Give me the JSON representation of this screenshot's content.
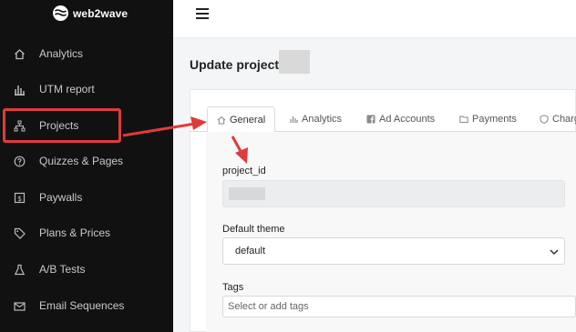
{
  "app": {
    "name": "web2wave"
  },
  "sidebar": {
    "items": [
      {
        "label": "Analytics",
        "icon": "home-icon"
      },
      {
        "label": "UTM report",
        "icon": "bar-chart-icon"
      },
      {
        "label": "Projects",
        "icon": "sitemap-icon"
      },
      {
        "label": "Quizzes & Pages",
        "icon": "question-circle-icon"
      },
      {
        "label": "Paywalls",
        "icon": "dollar-page-icon"
      },
      {
        "label": "Plans & Prices",
        "icon": "tag-icon"
      },
      {
        "label": "A/B Tests",
        "icon": "flask-icon"
      },
      {
        "label": "Email Sequences",
        "icon": "envelope-icon"
      }
    ]
  },
  "page": {
    "title": "Update project:"
  },
  "tabs": [
    {
      "label": "General",
      "icon": "home-icon"
    },
    {
      "label": "Analytics",
      "icon": "bar-chart-icon"
    },
    {
      "label": "Ad Accounts",
      "icon": "facebook-icon"
    },
    {
      "label": "Payments",
      "icon": "folder-icon"
    },
    {
      "label": "Charg",
      "icon": "shield-icon"
    }
  ],
  "form": {
    "project_id_label": "project_id",
    "theme_label": "Default theme",
    "theme_value": "default",
    "tags_label": "Tags",
    "tags_placeholder": "Select or add tags"
  },
  "colors": {
    "sidebar_bg": "#111111",
    "annotation_red": "#e03b3b"
  }
}
